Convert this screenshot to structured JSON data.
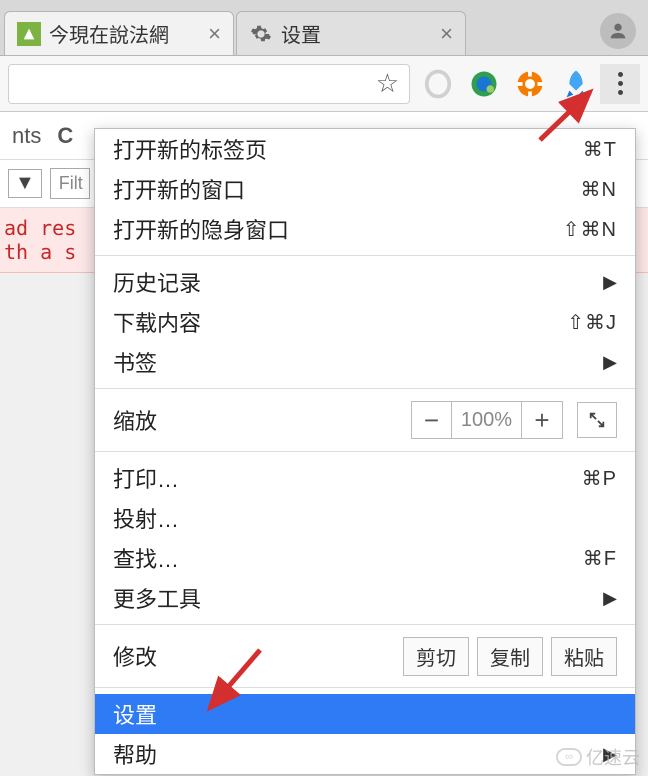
{
  "tabs": [
    {
      "title": "今現在說法網",
      "favicon_type": "green"
    },
    {
      "title": "设置",
      "favicon_type": "gear"
    }
  ],
  "toolbar": {
    "star_char": "☆"
  },
  "devtools": {
    "seg1": "nts",
    "seg2": "C",
    "dropdown_char": "▼",
    "filter_placeholder": "Filt"
  },
  "console": {
    "line1": "ad res",
    "line2": "th a s"
  },
  "menu": {
    "new_tab": {
      "label": "打开新的标签页",
      "shortcut": "⌘T"
    },
    "new_window": {
      "label": "打开新的窗口",
      "shortcut": "⌘N"
    },
    "new_incognito": {
      "label": "打开新的隐身窗口",
      "shortcut": "⇧⌘N"
    },
    "history": {
      "label": "历史记录"
    },
    "downloads": {
      "label": "下载内容",
      "shortcut": "⇧⌘J"
    },
    "bookmarks": {
      "label": "书签"
    },
    "zoom": {
      "label": "缩放",
      "value": "100%",
      "minus": "−",
      "plus": "+"
    },
    "print": {
      "label": "打印…",
      "shortcut": "⌘P"
    },
    "cast": {
      "label": "投射…"
    },
    "find": {
      "label": "查找…",
      "shortcut": "⌘F"
    },
    "more_tools": {
      "label": "更多工具"
    },
    "edit": {
      "label": "修改",
      "cut": "剪切",
      "copy": "复制",
      "paste": "粘贴"
    },
    "settings": {
      "label": "设置"
    },
    "help": {
      "label": "帮助"
    }
  },
  "watermark": "亿速云"
}
